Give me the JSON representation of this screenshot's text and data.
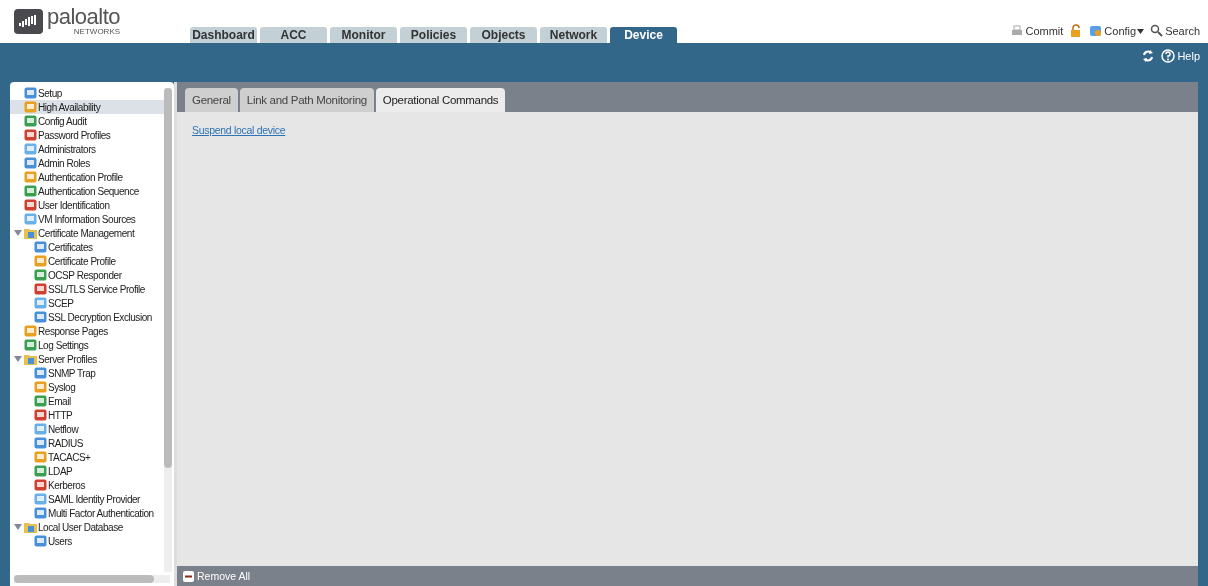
{
  "logo": {
    "name": "paloalto",
    "sub": "NETWORKS"
  },
  "main_tabs": [
    {
      "label": "Dashboard",
      "selected": false
    },
    {
      "label": "ACC",
      "selected": false
    },
    {
      "label": "Monitor",
      "selected": false
    },
    {
      "label": "Policies",
      "selected": false
    },
    {
      "label": "Objects",
      "selected": false
    },
    {
      "label": "Network",
      "selected": false
    },
    {
      "label": "Device",
      "selected": true
    }
  ],
  "top_actions": [
    {
      "kind": "commit",
      "label": "Commit"
    },
    {
      "kind": "lock"
    },
    {
      "kind": "config",
      "label": "Config"
    },
    {
      "kind": "search",
      "label": "Search"
    }
  ],
  "toolbar": [
    {
      "kind": "refresh"
    },
    {
      "kind": "help",
      "label": "Help"
    }
  ],
  "sidebar": {
    "items": [
      {
        "label": "Setup",
        "selected": false
      },
      {
        "label": "High Availability",
        "selected": true
      },
      {
        "label": "Config Audit",
        "selected": false
      },
      {
        "label": "Password Profiles",
        "selected": false
      },
      {
        "label": "Administrators",
        "selected": false
      },
      {
        "label": "Admin Roles",
        "selected": false
      },
      {
        "label": "Authentication Profile",
        "selected": false
      },
      {
        "label": "Authentication Sequence",
        "selected": false
      },
      {
        "label": "User Identification",
        "selected": false
      },
      {
        "label": "VM Information Sources",
        "selected": false
      },
      {
        "label": "Certificate Management",
        "selected": false,
        "expanded": true,
        "children": [
          {
            "label": "Certificates",
            "selected": false
          },
          {
            "label": "Certificate Profile",
            "selected": false
          },
          {
            "label": "OCSP Responder",
            "selected": false
          },
          {
            "label": "SSL/TLS Service Profile",
            "selected": false
          },
          {
            "label": "SCEP",
            "selected": false
          },
          {
            "label": "SSL Decryption Exclusion",
            "selected": false
          }
        ]
      },
      {
        "label": "Response Pages",
        "selected": false
      },
      {
        "label": "Log Settings",
        "selected": false
      },
      {
        "label": "Server Profiles",
        "selected": false,
        "expanded": true,
        "children": [
          {
            "label": "SNMP Trap",
            "selected": false
          },
          {
            "label": "Syslog",
            "selected": false
          },
          {
            "label": "Email",
            "selected": false
          },
          {
            "label": "HTTP",
            "selected": false
          },
          {
            "label": "Netflow",
            "selected": false
          },
          {
            "label": "RADIUS",
            "selected": false
          },
          {
            "label": "TACACS+",
            "selected": false
          },
          {
            "label": "LDAP",
            "selected": false
          },
          {
            "label": "Kerberos",
            "selected": false
          },
          {
            "label": "SAML Identity Provider",
            "selected": false
          },
          {
            "label": "Multi Factor Authentication",
            "selected": false
          }
        ]
      },
      {
        "label": "Local User Database",
        "selected": false,
        "expanded": true,
        "children": [
          {
            "label": "Users",
            "selected": false
          }
        ]
      }
    ]
  },
  "sub_tabs": [
    {
      "label": "General",
      "selected": false
    },
    {
      "label": "Link and Path Monitoring",
      "selected": false
    },
    {
      "label": "Operational Commands",
      "selected": true
    }
  ],
  "content": {
    "link": "Suspend local device"
  },
  "footer": {
    "button": "Remove All"
  }
}
